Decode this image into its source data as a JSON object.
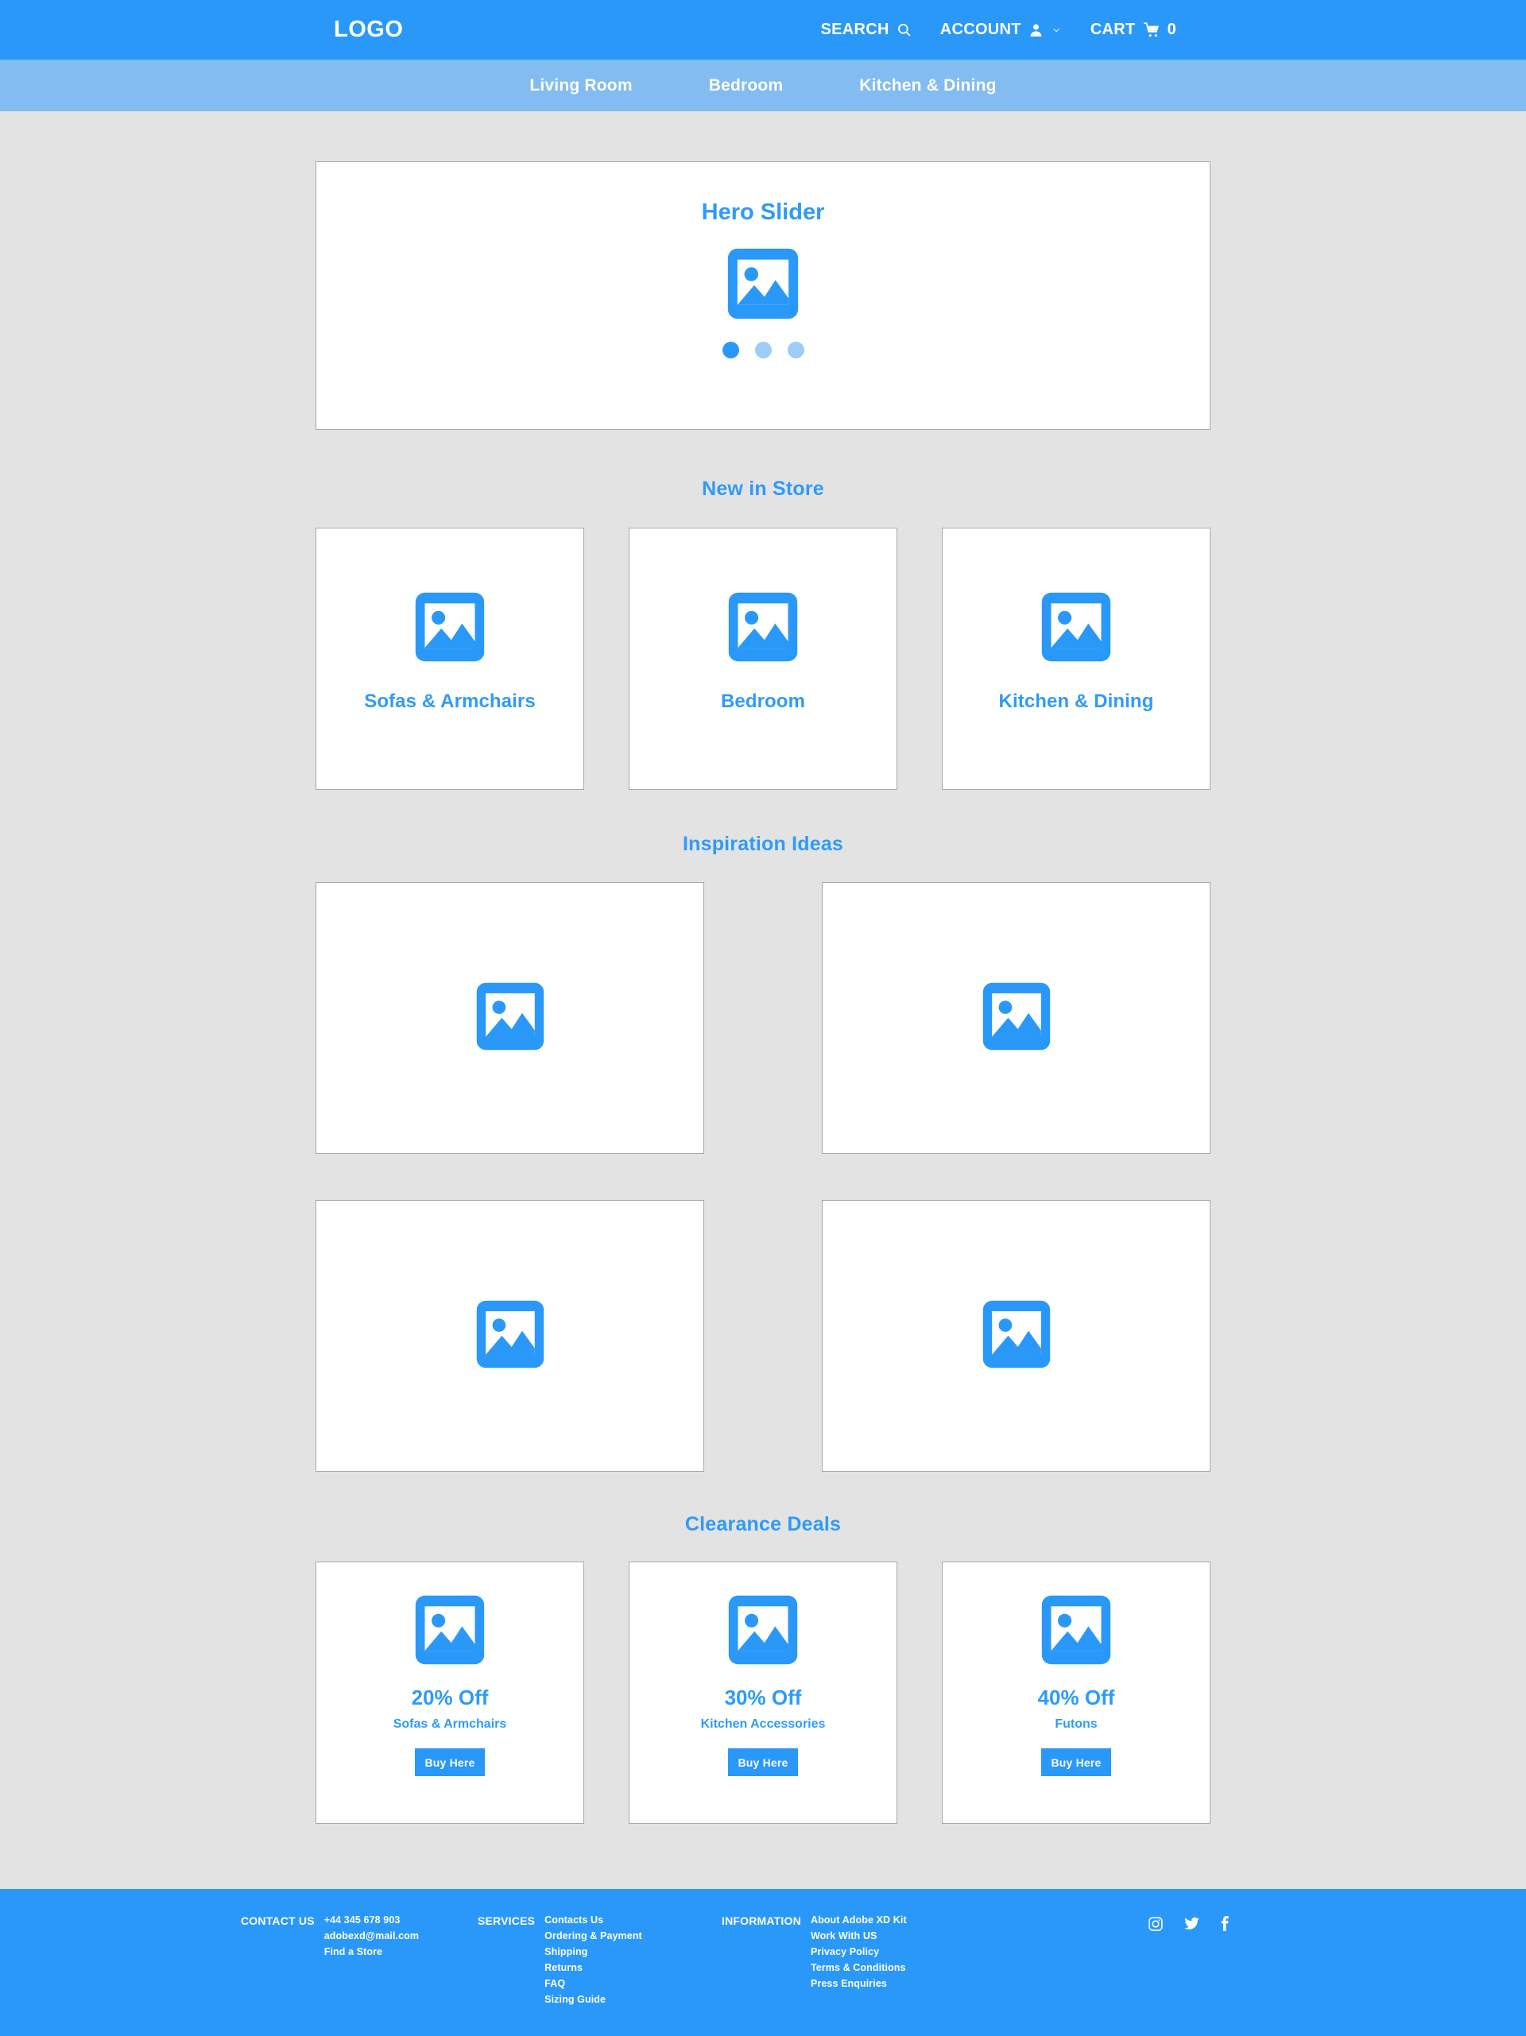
{
  "colors": {
    "brand_blue": "#2a98f8",
    "nav_blue": "#82bcf0",
    "title_blue": "#2e9bf8",
    "page_bg": "#e3e3e3",
    "card_border": "#a9a9a9",
    "dot_active": "#2a98f8",
    "dot_inactive": "#9dcdf7"
  },
  "header": {
    "logo": "LOGO",
    "actions": {
      "search_label": "SEARCH",
      "account_label": "ACCOUNT",
      "cart_label": "CART",
      "cart_count": "0"
    }
  },
  "nav": {
    "items": [
      {
        "label": "Living Room"
      },
      {
        "label": "Bedroom"
      },
      {
        "label": "Kitchen & Dining"
      }
    ]
  },
  "hero": {
    "title": "Hero Slider",
    "dots": [
      {
        "state": "active"
      },
      {
        "state": "inactive"
      },
      {
        "state": "inactive"
      }
    ]
  },
  "new_in_store": {
    "title": "New in Store",
    "cards": [
      {
        "label": "Sofas & Armchairs"
      },
      {
        "label": "Bedroom"
      },
      {
        "label": "Kitchen & Dining"
      }
    ]
  },
  "inspiration": {
    "title": "Inspiration Ideas",
    "cards": [
      {
        "icon": "image-placeholder-icon"
      },
      {
        "icon": "image-placeholder-icon"
      },
      {
        "icon": "image-placeholder-icon"
      },
      {
        "icon": "image-placeholder-icon"
      }
    ]
  },
  "clearance": {
    "title": "Clearance Deals",
    "cards": [
      {
        "percent": "20% Off",
        "subtitle": "Sofas & Armchairs",
        "button": "Buy Here"
      },
      {
        "percent": "30% Off",
        "subtitle": "Kitchen Accessories",
        "button": "Buy Here"
      },
      {
        "percent": "40% Off",
        "subtitle": "Futons",
        "button": "Buy Here"
      }
    ]
  },
  "footer": {
    "columns": [
      {
        "heading": "CONTACT US",
        "links": [
          "+44 345 678 903",
          "adobexd@mail.com",
          "Find a Store"
        ]
      },
      {
        "heading": "SERVICES",
        "links": [
          "Contacts Us",
          "Ordering & Payment",
          "Shipping",
          "Returns",
          "FAQ",
          "Sizing Guide"
        ]
      },
      {
        "heading": "INFORMATION",
        "links": [
          "About Adobe XD Kit",
          "Work With US",
          "Privacy Policy",
          "Terms & Conditions",
          "Press Enquiries"
        ]
      }
    ],
    "social": [
      {
        "name": "instagram-icon"
      },
      {
        "name": "twitter-icon"
      },
      {
        "name": "facebook-icon"
      }
    ]
  }
}
